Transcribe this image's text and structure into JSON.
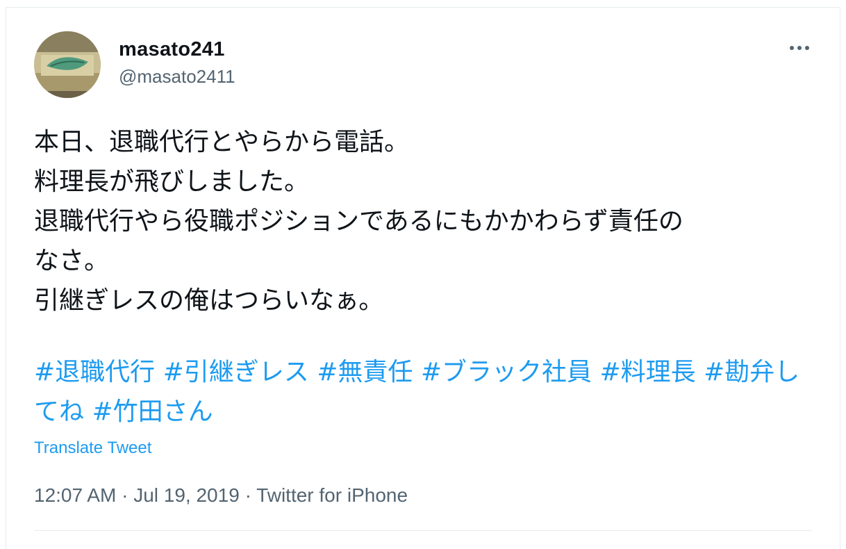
{
  "user": {
    "name": "masato241",
    "handle": "@masato2411"
  },
  "icons": {
    "more": "more-horizontal-icon",
    "avatar": "avatar-leaf-image"
  },
  "tweet": {
    "lines": [
      "本日、退職代行とやらから電話。",
      "料理長が飛びしました。",
      "退職代行やら役職ポジションであるにもかかわらず責任の",
      "なさ。",
      "引継ぎレスの俺はつらいなぁ。"
    ],
    "hashtags": [
      "#退職代行",
      "#引継ぎレス",
      "#無責任",
      "#ブラック社員",
      "#料理長",
      "#勘弁してね",
      "#竹田さん"
    ],
    "translate_label": "Translate Tweet",
    "time": "12:07 AM",
    "date": "Jul 19, 2019",
    "source": "Twitter for iPhone",
    "separator": "·"
  },
  "colors": {
    "link": "#1d9bf0",
    "secondary_text": "#536471",
    "primary_text": "#0f1419",
    "border": "#e6ecf0"
  }
}
